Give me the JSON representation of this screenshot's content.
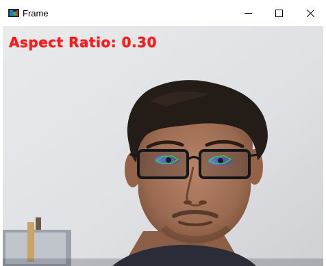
{
  "window": {
    "title": "Frame",
    "controls": {
      "minimize_icon": "minimize-icon",
      "maximize_icon": "maximize-icon",
      "close_icon": "close-icon"
    }
  },
  "overlay": {
    "aspect_ratio_text": "Aspect Ratio: 0.30",
    "text_color": "#ff1a1a",
    "eye_contour_color": "#22dd22"
  }
}
